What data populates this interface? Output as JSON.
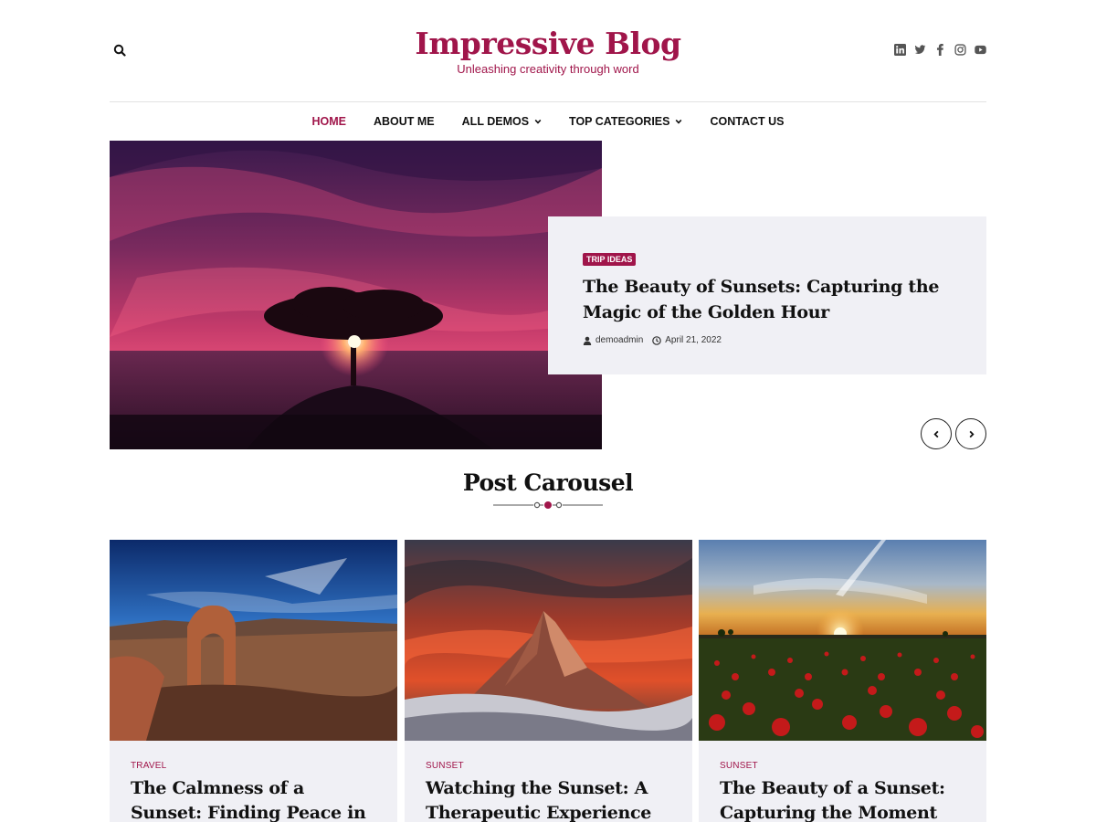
{
  "site": {
    "title": "Impressive Blog",
    "tagline": "Unleashing creativity through word"
  },
  "header": {
    "search_icon": "search-icon",
    "socials": [
      "linkedin-icon",
      "twitter-icon",
      "facebook-icon",
      "instagram-icon",
      "youtube-icon"
    ]
  },
  "nav": {
    "items": [
      {
        "label": "HOME",
        "active": true
      },
      {
        "label": "ABOUT ME",
        "active": false
      },
      {
        "label": "ALL DEMOS",
        "active": false,
        "dropdown": true
      },
      {
        "label": "TOP CATEGORIES",
        "active": false,
        "dropdown": true
      },
      {
        "label": "CONTACT US",
        "active": false
      }
    ]
  },
  "hero": {
    "tag": "TRIP IDEAS",
    "title": "The Beauty of Sunsets: Capturing the Magic of the Golden Hour",
    "author": "demoadmin",
    "date": "April 21, 2022",
    "prev_icon": "chevron-left-icon",
    "next_icon": "chevron-right-icon"
  },
  "carousel": {
    "title": "Post Carousel",
    "posts": [
      {
        "category": "TRAVEL",
        "title": "The Calmness of a Sunset: Finding Peace in the Moment"
      },
      {
        "category": "SUNSET",
        "title": "Watching the Sunset: A Therapeutic Experience"
      },
      {
        "category": "SUNSET",
        "title": "The Beauty of a Sunset: Capturing the Moment"
      }
    ]
  },
  "colors": {
    "accent": "#a0154a",
    "card_bg": "#f0f0f5"
  }
}
